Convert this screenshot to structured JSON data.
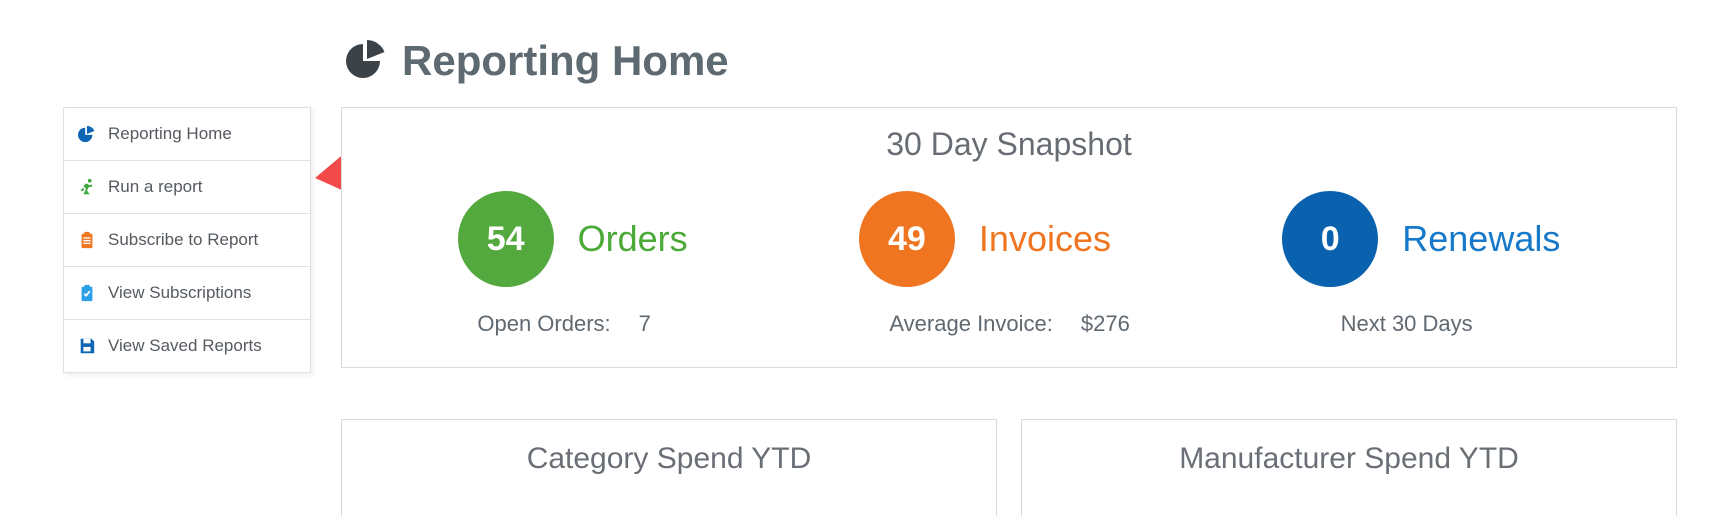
{
  "header": {
    "title": "Reporting Home"
  },
  "sidebar": {
    "items": [
      {
        "label": "Reporting Home"
      },
      {
        "label": "Run a report"
      },
      {
        "label": "Subscribe to Report"
      },
      {
        "label": "View Subscriptions"
      },
      {
        "label": "View Saved Reports"
      }
    ]
  },
  "snapshot": {
    "title": "30 Day Snapshot",
    "orders": {
      "count": "54",
      "label": "Orders",
      "sub_label": "Open Orders:",
      "sub_value": "7"
    },
    "invoices": {
      "count": "49",
      "label": "Invoices",
      "sub_label": "Average Invoice:",
      "sub_value": "$276"
    },
    "renewals": {
      "count": "0",
      "label": "Renewals",
      "sub_label": "Next 30 Days"
    }
  },
  "bottom_panels": {
    "left": "Category Spend YTD",
    "right": "Manufacturer Spend YTD"
  },
  "colors": {
    "green": "#54a93e",
    "orange": "#ef7521",
    "blue": "#0a61ad"
  }
}
